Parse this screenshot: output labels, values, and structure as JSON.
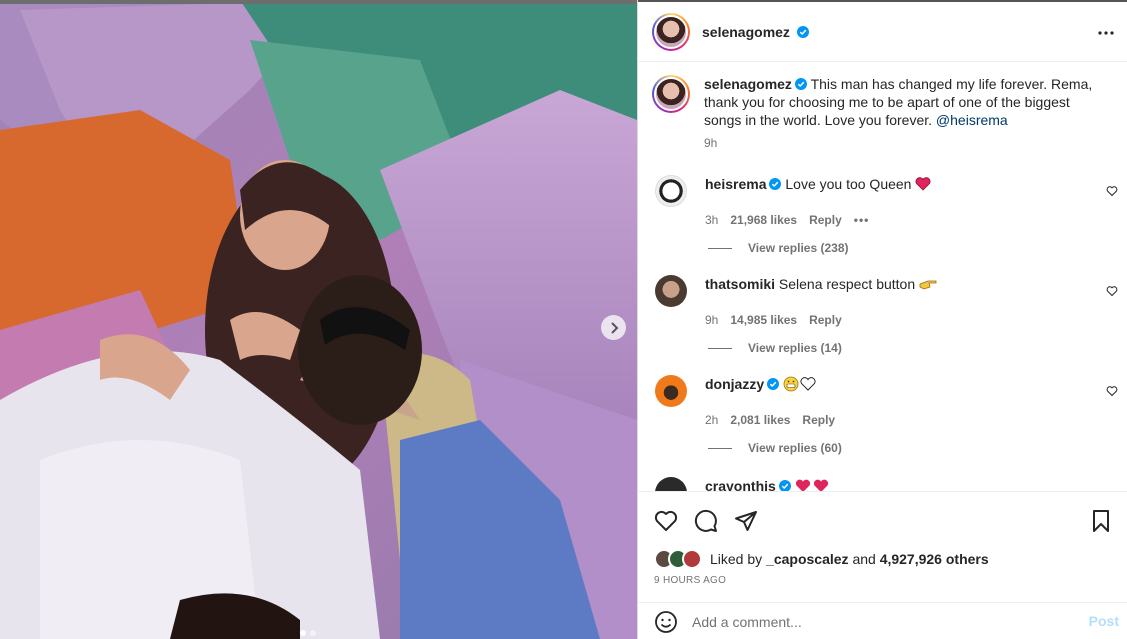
{
  "post": {
    "username": "selenagomez",
    "caption_text": "This man has changed my life forever. Rema, thank you for choosing me to be apart of one of the biggest songs in the world. Love you forever.",
    "caption_mention": "@heisrema",
    "caption_time": "9h"
  },
  "comments": [
    {
      "username": "heisrema",
      "text": "Love you too Queen",
      "emoji": "red-heart",
      "time": "3h",
      "likes": "21,968 likes",
      "reply": "Reply",
      "more": "•••",
      "view_replies": "View replies (238)"
    },
    {
      "username": "thatsomiki",
      "text": "Selena respect button",
      "emoji": "pointing-hand",
      "time": "9h",
      "likes": "14,985 likes",
      "reply": "Reply",
      "view_replies": "View replies (14)"
    },
    {
      "username": "donjazzy",
      "text": "",
      "emoji": "grin-face-white-heart",
      "time": "2h",
      "likes": "2,081 likes",
      "reply": "Reply",
      "view_replies": "View replies (60)"
    },
    {
      "username": "crayonthis",
      "text": "",
      "emoji": "red-hearts"
    }
  ],
  "liked_by": {
    "prefix": "Liked by",
    "user": "_caposcalez",
    "middle": "and",
    "count": "4,927,926 others"
  },
  "post_time": "9 HOURS AGO",
  "add_comment_placeholder": "Add a comment...",
  "post_button": "Post",
  "icons": {
    "more": "more-horizontal-icon",
    "like": "heart-icon",
    "comment": "comment-icon",
    "share": "share-icon",
    "save": "bookmark-icon",
    "emoji": "emoji-icon",
    "next": "chevron-right-icon"
  },
  "colors": {
    "verified": "#0095f6",
    "link": "#00376b",
    "post_disabled": "#b2dffc",
    "secondary_text": "#737373"
  }
}
